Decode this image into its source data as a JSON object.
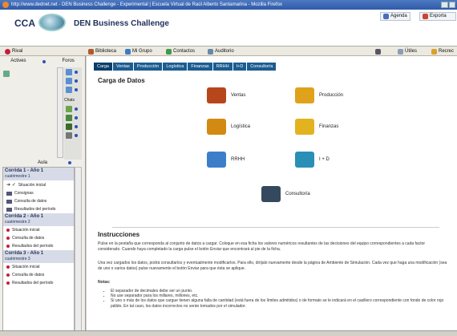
{
  "window": {
    "title": "http://www.dednet.net - DEN Business Challenge - Experimental | Escuela Virtual de Raúl Alberto Santamarina - Mozilla Firefox"
  },
  "header": {
    "logo_text": "CCA",
    "app_title": "DEN Business Challenge",
    "agenda": "Agenda",
    "exporta": "Exporta"
  },
  "navbar": {
    "items": [
      {
        "label": "Rival",
        "icon": "red-dot-icon"
      },
      {
        "label": "Biblioteca",
        "icon": "books-icon"
      },
      {
        "label": "Mi Grupo",
        "icon": "group-icon"
      },
      {
        "label": "Contactos",
        "icon": "contacts-icon"
      },
      {
        "label": "Auditorio",
        "icon": "auditorium-icon"
      },
      {
        "label": "Útiles",
        "icon": "tools-icon"
      },
      {
        "label": "Recrec",
        "icon": "recreo-icon"
      }
    ]
  },
  "left": {
    "tab_actives": "Actives",
    "tab_foros": "Foros",
    "chats": "Chats",
    "aula": "Aula",
    "corridas": [
      {
        "title": "Corrida 1 - Año 1",
        "sub": "cuatrimestre 1",
        "items": [
          {
            "label": "Situación inicial",
            "kind": "arrow"
          },
          {
            "label": "Consignas",
            "kind": "img"
          },
          {
            "label": "Consulta de datos",
            "kind": "img"
          },
          {
            "label": "Resultados del período",
            "kind": "img"
          }
        ]
      },
      {
        "title": "Corrida 2 - Año 1",
        "sub": "cuatrimestre 2",
        "items": [
          {
            "label": "Situación inicial",
            "kind": "dot"
          },
          {
            "label": "Consulta de datos",
            "kind": "dot"
          },
          {
            "label": "Resultados del período",
            "kind": "dot"
          }
        ]
      },
      {
        "title": "Corrida 3 - Año 1",
        "sub": "cuatrimestre 3",
        "items": [
          {
            "label": "Situación inicial",
            "kind": "dot"
          },
          {
            "label": "Consulta de datos",
            "kind": "dot"
          },
          {
            "label": "Resultados del período",
            "kind": "dot"
          }
        ]
      }
    ]
  },
  "content": {
    "tabs": [
      "Carga",
      "Ventas",
      "Producción",
      "Logística",
      "Finanzas",
      "RRHH",
      "I+D",
      "Consultoría"
    ],
    "page_title": "Carga de Datos",
    "items": [
      {
        "label": "Ventas",
        "icon": "briefcase-icon",
        "color": "#b8461c"
      },
      {
        "label": "Producción",
        "icon": "hardhat-icon",
        "color": "#e0a21a"
      },
      {
        "label": "Logística",
        "icon": "forklift-icon",
        "color": "#d38a12"
      },
      {
        "label": "Finanzas",
        "icon": "coins-icon",
        "color": "#e2b31e"
      },
      {
        "label": "RRHH",
        "icon": "people-icon",
        "color": "#3e7ec9"
      },
      {
        "label": "I + D",
        "icon": "flask-icon",
        "color": "#2a8fb6"
      },
      {
        "label": "Consultoría",
        "icon": "pen-icon",
        "color": "#34495e"
      }
    ],
    "instructions_title": "Instrucciones",
    "para1": "Pulse en la pestaña que corresponda al conjunto de datos a cargar. Coloque en esa ficha los valores numéricos resultantes de las decisiones del equipo correspondientes a cada factor considerado. Cuando haya completado la carga pulse el botón Enviar que encontrará al pie de la ficha.",
    "para2": "Una vez cargados los datos, podrá consultarlos y eventualmente modificarlos. Para ello, diríjalo nuevamente desde la página de Ambiente de Simulación. Cada vez que haga una modificación (sea de uno o varios datos) pulse nuevamente el botón Enviar para que ésta se aplique.",
    "notes_title": "Notas:",
    "notes": [
      "El separador de decimales debe ser un punto.",
      "No use separador para los millares, millones, etc.",
      "Si uno o más de los datos que cargue tienen alguna falla de cantidad (está fuera de los límites admitidos) o de formato se le indicará en el casillero correspondiente con fondo de color rojo pálido. En tal caso, los datos incorrectos no serán tomados por el simulador."
    ]
  }
}
